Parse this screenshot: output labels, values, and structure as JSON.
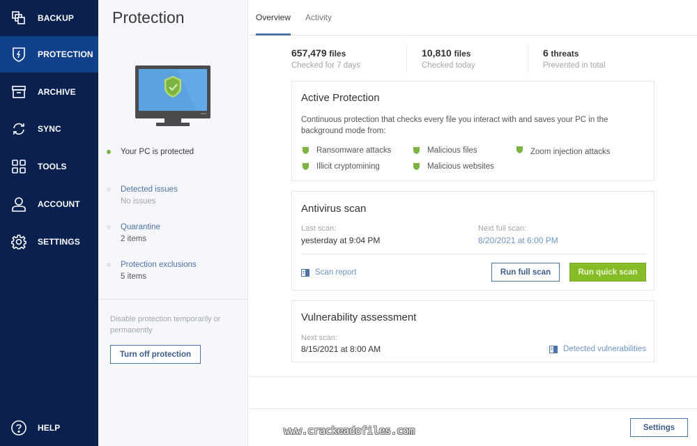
{
  "sidebar": {
    "items": [
      {
        "label": "BACKUP",
        "icon": "backup-icon",
        "active": false
      },
      {
        "label": "PROTECTION",
        "icon": "shield-bolt-icon",
        "active": true
      },
      {
        "label": "ARCHIVE",
        "icon": "archive-box-icon",
        "active": false
      },
      {
        "label": "SYNC",
        "icon": "sync-icon",
        "active": false
      },
      {
        "label": "TOOLS",
        "icon": "grid-icon",
        "active": false
      },
      {
        "label": "ACCOUNT",
        "icon": "user-icon",
        "active": false
      },
      {
        "label": "SETTINGS",
        "icon": "gear-icon",
        "active": false
      }
    ],
    "help": {
      "label": "HELP",
      "icon": "question-circle-icon"
    }
  },
  "left_panel": {
    "title": "Protection",
    "status": "Your PC is protected",
    "links": [
      {
        "label": "Detected issues",
        "sub": "No issues"
      },
      {
        "label": "Quarantine",
        "sub": "2 items"
      },
      {
        "label": "Protection exclusions",
        "sub": "5 items"
      }
    ],
    "disable_text": "Disable protection temporarily or permanently",
    "turn_off_label": "Turn off protection"
  },
  "tabs": [
    {
      "label": "Overview",
      "active": true
    },
    {
      "label": "Activity",
      "active": false
    }
  ],
  "stats": [
    {
      "value": "657,479",
      "unit": "files",
      "label": "Checked for 7 days"
    },
    {
      "value": "10,810",
      "unit": "files",
      "label": "Checked today"
    },
    {
      "value": "6",
      "unit": "threats",
      "label": "Prevented in total"
    }
  ],
  "active_protection": {
    "title": "Active Protection",
    "description": "Continuous protection that checks every file you interact with and saves your PC in the background mode from:",
    "features": [
      "Ransomware attacks",
      "Malicious files",
      "Zoom injection attacks",
      "Illicit cryptomining",
      "Malicious websites"
    ]
  },
  "antivirus_scan": {
    "title": "Antivirus scan",
    "last_scan_label": "Last scan:",
    "last_scan_value": "yesterday at 9:04 PM",
    "next_scan_label": "Next full scan:",
    "next_scan_value": "8/20/2021 at 6:00 PM",
    "scan_report_label": "Scan report",
    "run_full_label": "Run full scan",
    "run_quick_label": "Run quick scan"
  },
  "vulnerability": {
    "title": "Vulnerability assessment",
    "next_scan_label": "Next scan:",
    "next_scan_value": "8/15/2021 at 8:00 AM",
    "detected_label": "Detected vulnerabilities"
  },
  "footer": {
    "watermark": "www.crackeadofiles.com",
    "settings_label": "Settings"
  },
  "colors": {
    "sidebar_bg": "#0a2150",
    "sidebar_active": "#10418a",
    "accent_blue": "#4d73a6",
    "accent_green": "#86bc25"
  }
}
